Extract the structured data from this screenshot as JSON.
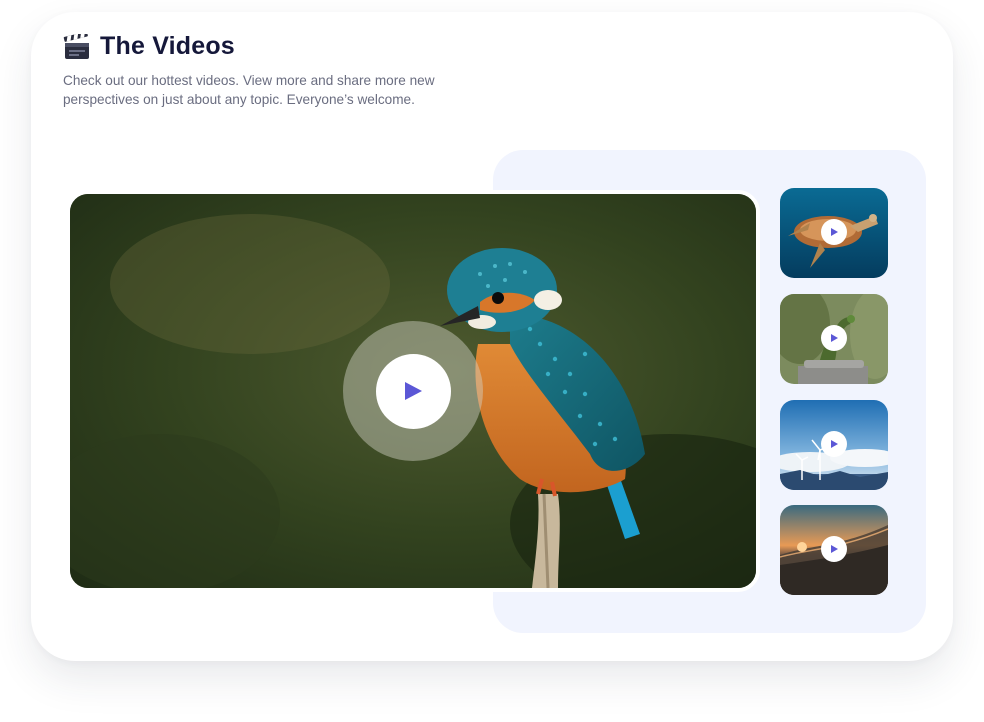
{
  "header": {
    "icon": "clapperboard-icon",
    "title": "The Videos",
    "subtitle": "Check out our hottest videos. View more and share more new perspectives on just about any topic. Everyone’s welcome."
  },
  "colors": {
    "accent": "#5b57d6",
    "title": "#15183a",
    "subtitle": "#6a6d80",
    "panel": "#f1f4fe"
  },
  "main_video": {
    "subject": "kingfisher-bird",
    "play_icon": "play-icon"
  },
  "thumbnails": [
    {
      "subject": "sea-turtle",
      "play_icon": "play-icon"
    },
    {
      "subject": "lizard-on-rock",
      "play_icon": "play-icon"
    },
    {
      "subject": "wind-turbines",
      "play_icon": "play-icon"
    },
    {
      "subject": "ocean-wave-sunset",
      "play_icon": "play-icon"
    }
  ]
}
